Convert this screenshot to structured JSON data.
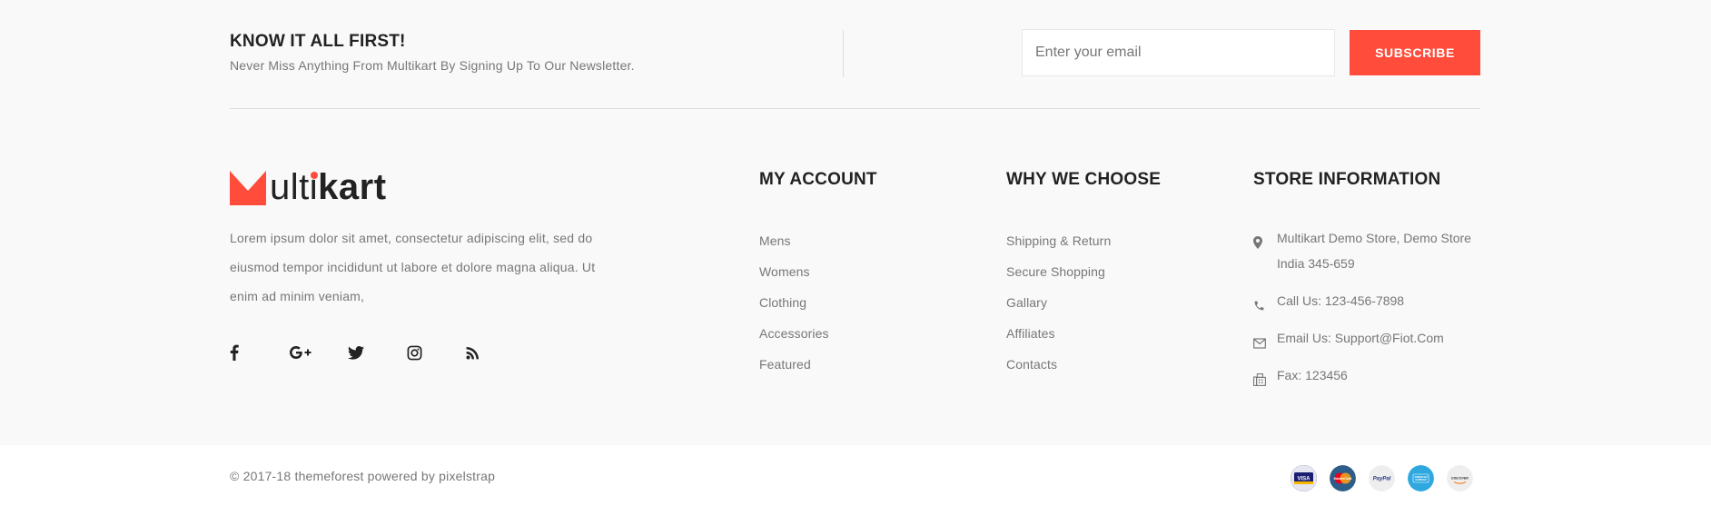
{
  "newsletter": {
    "title": "KNOW IT ALL FIRST!",
    "subtitle": "Never Miss Anything From Multikart By Signing Up To Our Newsletter.",
    "email_placeholder": "Enter your email",
    "subscribe_label": "SUBSCRIBE"
  },
  "brand": {
    "name_light": "ulti",
    "name_bold": "kart",
    "accent_color": "#ff4c3b",
    "about": "Lorem ipsum dolor sit amet, consectetur adipiscing elit, sed do eiusmod tempor incididunt ut labore et dolore magna aliqua. Ut enim ad minim veniam,"
  },
  "social": [
    {
      "icon": "facebook-icon"
    },
    {
      "icon": "google-plus-icon"
    },
    {
      "icon": "twitter-icon"
    },
    {
      "icon": "instagram-icon"
    },
    {
      "icon": "rss-icon"
    }
  ],
  "my_account": {
    "title": "MY ACCOUNT",
    "items": [
      "Mens",
      "Womens",
      "Clothing",
      "Accessories",
      "Featured"
    ]
  },
  "why_we_choose": {
    "title": "WHY WE CHOOSE",
    "items": [
      "Shipping & Return",
      "Secure Shopping",
      "Gallary",
      "Affiliates",
      "Contacts"
    ]
  },
  "store_information": {
    "title": "STORE INFORMATION",
    "address": "Multikart Demo Store, Demo Store India 345-659",
    "phone": "Call Us: 123-456-7898",
    "email": "Email Us: Support@Fiot.Com",
    "fax": "Fax: 123456"
  },
  "subfooter": {
    "copyright": "© 2017-18 themeforest powered by pixelstrap",
    "payments": [
      {
        "name": "VISA",
        "color": "#1a1f71"
      },
      {
        "name": "MasterCard",
        "color": "#2f5d8a"
      },
      {
        "name": "PayPal",
        "color": "#eeeeee"
      },
      {
        "name": "AMERICAN EXPRESS",
        "color": "#2fa8e0"
      },
      {
        "name": "DISCOVER",
        "color": "#eeeeee"
      }
    ]
  }
}
